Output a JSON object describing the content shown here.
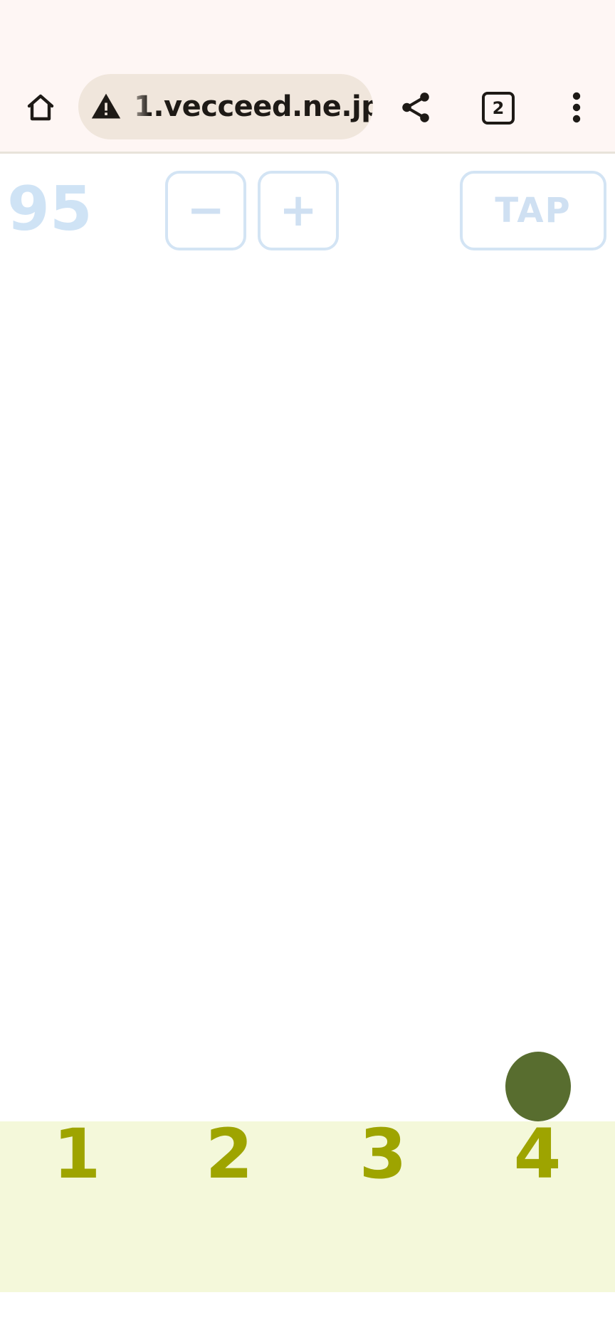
{
  "browser": {
    "url": "1.vecceed.ne.jp",
    "tab_count": "2",
    "icons": {
      "home": "home-icon",
      "security": "warning-icon",
      "share": "share-icon",
      "tabs": "tab-switcher-icon",
      "menu": "more-vert-icon"
    }
  },
  "game": {
    "counter": "95",
    "minus_label": "−",
    "plus_label": "+",
    "tap_label": "TAP",
    "lanes": [
      "1",
      "2",
      "3",
      "4"
    ],
    "colors": {
      "controls": "#cfe0f2",
      "lane_label": "#9ea400",
      "lane_bg": "#f4f8da",
      "dot": "#586d2f"
    }
  }
}
